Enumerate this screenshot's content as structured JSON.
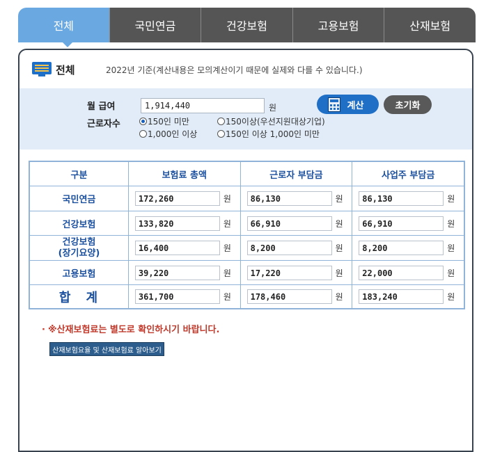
{
  "tabs": [
    "전체",
    "국민연금",
    "건강보험",
    "고용보험",
    "산재보험"
  ],
  "title": "전체",
  "notice": "2022년 기준(계산내용은 모의계산이기 때문에 실제와 다를 수 있습니다.)",
  "form": {
    "salary_label": "월 급여",
    "salary_value": "1,914,440",
    "salary_unit": "원",
    "workers_label": "근로자수",
    "options": [
      {
        "label": "150인 미만",
        "selected": true
      },
      {
        "label": "150이상(우선지원대상기업)",
        "selected": false
      },
      {
        "label": "1,000인 이상",
        "selected": false
      },
      {
        "label": "150인 이상 1,000인 미만",
        "selected": false
      }
    ],
    "calc_button": "계산",
    "reset_button": "초기화"
  },
  "table": {
    "headers": [
      "구분",
      "보험료 총액",
      "근로자 부담금",
      "사업주 부담금"
    ],
    "unit": "원",
    "rows": [
      {
        "label": "국민연금",
        "total": "172,260",
        "worker": "86,130",
        "employer": "86,130"
      },
      {
        "label": "건강보험",
        "total": "133,820",
        "worker": "66,910",
        "employer": "66,910"
      },
      {
        "label": "건강보험\n(장기요양)",
        "label1": "건강보험",
        "label2": "(장기요양)",
        "total": "16,400",
        "worker": "8,200",
        "employer": "8,200"
      },
      {
        "label": "고용보험",
        "total": "39,220",
        "worker": "17,220",
        "employer": "22,000"
      },
      {
        "label": "합계",
        "total": "361,700",
        "worker": "178,460",
        "employer": "183,240"
      }
    ]
  },
  "warning": "※산재보험료는 별도로 확인하시기 바랍니다.",
  "link_button": "산재보험요율 및 산재보험료 알아보기",
  "colors": {
    "active_tab": "#6aa8e2",
    "tab": "#555555",
    "calc_button": "#1f6fc7",
    "header_text": "#1a4f9e",
    "warning": "#c0392b"
  }
}
